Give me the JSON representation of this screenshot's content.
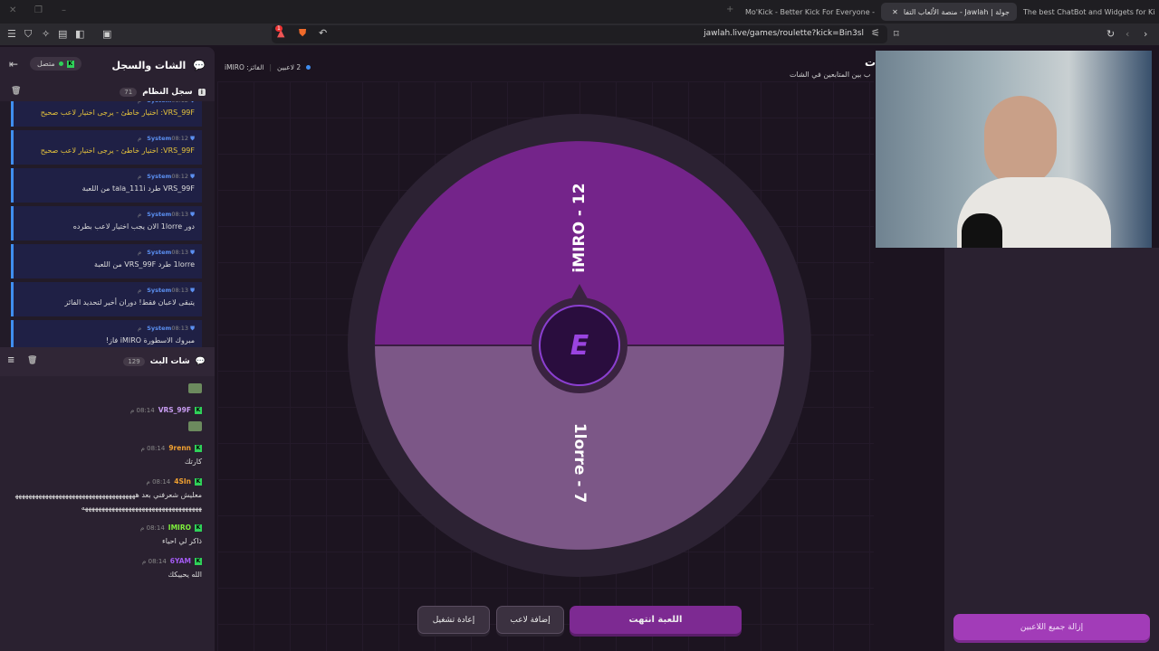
{
  "browser": {
    "tabs": [
      {
        "label": "The best ChatBot and Widgets for Ki"
      },
      {
        "label": "جولة | Jawlah - منصة الألعاب التفا",
        "active": true
      },
      {
        "label": "Mo'Kick - Better Kick For Everyone -"
      }
    ],
    "url": "jawlah.live/games/roulette?kick=Bin3sl",
    "shield_badge": "1"
  },
  "chat": {
    "title": "الشات والسجل",
    "status": "متصل",
    "system_log": {
      "title": "سجل النظام",
      "count": "71",
      "messages": [
        {
          "sender": "System",
          "time": "08:12 م",
          "text": "VRS_99F: اختيار خاطئ - يرجى اختيار لاعب صحيح",
          "warn": true
        },
        {
          "sender": "System",
          "time": "08:12 م",
          "text": "VRS_99F: اختيار خاطئ - يرجى اختيار لاعب صحيح",
          "warn": true
        },
        {
          "sender": "System",
          "time": "08:12 م",
          "text": "VRS_99F طرد tala_111i من اللعبة"
        },
        {
          "sender": "System",
          "time": "08:13 م",
          "text": "دور 1lorre الان يجب اختيار لاعب بطرده"
        },
        {
          "sender": "System",
          "time": "08:13 م",
          "text": "1lorre طرد VRS_99F من اللعبة"
        },
        {
          "sender": "System",
          "time": "08:13 م",
          "text": "يتبقى لاعبان فقط! دوران أخير لتحديد الفائز"
        },
        {
          "sender": "System",
          "time": "08:13 م",
          "text": "مبروك الاسطورة iMIRO فاز!"
        }
      ]
    },
    "stream_chat": {
      "title": "شات البث",
      "count": "129",
      "messages": [
        {
          "user": "VRS_99F",
          "color": "#c79cf0",
          "time": "08:14 م",
          "text": "",
          "emote": true
        },
        {
          "user": "9renn",
          "color": "#f0a030",
          "time": "08:14 م",
          "text": "كارتك"
        },
        {
          "user": "4SIn",
          "color": "#f0a030",
          "time": "08:14 م",
          "text": "معليش شعرفني بعد ههههههههههههههههههههههههههههههههههههههههههههههههههههههههههههههههههههههههه"
        },
        {
          "user": "IMIRO",
          "color": "#7ef03c",
          "time": "08:14 م",
          "text": "ذاكر لي احياء"
        },
        {
          "user": "6YAM",
          "color": "#a25af0",
          "time": "08:14 م",
          "text": "الله يحييكك"
        }
      ]
    }
  },
  "game": {
    "players_count": "2 لاعبين",
    "winner": "الفائز: iMIRO",
    "title": "ت",
    "subtitle": "ب بين المتابعين في الشات",
    "wheel": [
      {
        "label": "iMIRO - 12",
        "color": "#74248a",
        "share": 0.5
      },
      {
        "label": "1lorre - 7",
        "color": "#7c5787",
        "share": 0.5
      }
    ],
    "hub_logo": "E",
    "buttons": {
      "status": "اللعبة انتهت",
      "add_player": "إضافة لاعب",
      "restart": "إعادة تشغيل"
    }
  },
  "right_panel": {
    "remove_all": "إزالة جميع اللاعبين"
  }
}
